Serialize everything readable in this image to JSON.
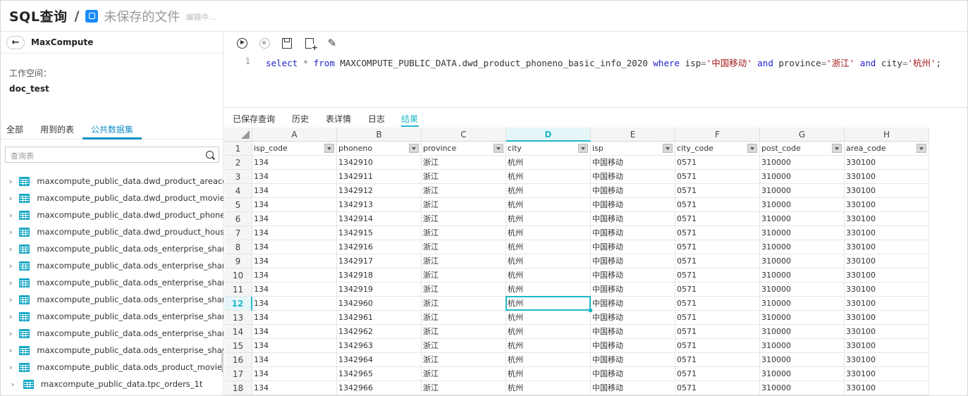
{
  "header": {
    "title": "SQL查询",
    "separator": "/",
    "file_name": "未保存的文件",
    "status": "编辑中..."
  },
  "left_panel": {
    "back_icon": "arrow-left-icon",
    "title": "MaxCompute",
    "workspace_label": "工作空间：",
    "workspace_value": "doc_test",
    "tabs": [
      "全部",
      "用到的表",
      "公共数据集"
    ],
    "active_tab": "公共数据集",
    "search_placeholder": "查询表",
    "tables": [
      "maxcompute_public_data.dwd_product_areacode",
      "maxcompute_public_data.dwd_product_movie_basic",
      "maxcompute_public_data.dwd_product_phoneno_basic",
      "maxcompute_public_data.dwd_prouduct_house",
      "maxcompute_public_data.ods_enterprise_share_basic",
      "maxcompute_public_data.ods_enterprise_share_quarter",
      "maxcompute_public_data.ods_enterprise_share_trade",
      "maxcompute_public_data.ods_enterprise_share_cashflow",
      "maxcompute_public_data.ods_enterprise_share_income",
      "maxcompute_public_data.ods_enterprise_share_profit",
      "maxcompute_public_data.ods_enterprise_share_holder",
      "maxcompute_public_data.ods_product_movie_box",
      "maxcompute_public_data.tpc_orders_1t"
    ]
  },
  "toolbar": {
    "icons": [
      "run-icon",
      "stop-icon",
      "save-icon",
      "save-as-icon",
      "format-icon"
    ]
  },
  "editor": {
    "line_number": "1",
    "tokens": [
      {
        "t": "select",
        "c": "kw"
      },
      {
        "t": " ",
        "c": "id"
      },
      {
        "t": "*",
        "c": "op"
      },
      {
        "t": " ",
        "c": "id"
      },
      {
        "t": "from",
        "c": "kw"
      },
      {
        "t": " MAXCOMPUTE_PUBLIC_DATA.dwd_product_phoneno_basic_info_2020 ",
        "c": "id"
      },
      {
        "t": "where",
        "c": "kw"
      },
      {
        "t": " isp",
        "c": "id"
      },
      {
        "t": "=",
        "c": "op"
      },
      {
        "t": "'中国移动'",
        "c": "str"
      },
      {
        "t": " ",
        "c": "id"
      },
      {
        "t": "and",
        "c": "kw"
      },
      {
        "t": " province",
        "c": "id"
      },
      {
        "t": "=",
        "c": "op"
      },
      {
        "t": "'浙江'",
        "c": "str"
      },
      {
        "t": " ",
        "c": "id"
      },
      {
        "t": "and",
        "c": "kw"
      },
      {
        "t": " city",
        "c": "id"
      },
      {
        "t": "=",
        "c": "op"
      },
      {
        "t": "'杭州'",
        "c": "str"
      },
      {
        "t": ";",
        "c": "id"
      }
    ]
  },
  "result_tabs": {
    "items": [
      "已保存查询",
      "历史",
      "表详情",
      "日志",
      "结果"
    ],
    "active": "结果"
  },
  "grid": {
    "columns": [
      "A",
      "B",
      "C",
      "D",
      "E",
      "F",
      "G",
      "H"
    ],
    "selected_column": "D",
    "selected_row": "12",
    "header_row": [
      "isp_code",
      "phoneno",
      "province",
      "city",
      "isp",
      "city_code",
      "post_code",
      "area_code"
    ],
    "rows": [
      [
        "134",
        "1342910",
        "浙江",
        "杭州",
        "中国移动",
        "0571",
        "310000",
        "330100"
      ],
      [
        "134",
        "1342911",
        "浙江",
        "杭州",
        "中国移动",
        "0571",
        "310000",
        "330100"
      ],
      [
        "134",
        "1342912",
        "浙江",
        "杭州",
        "中国移动",
        "0571",
        "310000",
        "330100"
      ],
      [
        "134",
        "1342913",
        "浙江",
        "杭州",
        "中国移动",
        "0571",
        "310000",
        "330100"
      ],
      [
        "134",
        "1342914",
        "浙江",
        "杭州",
        "中国移动",
        "0571",
        "310000",
        "330100"
      ],
      [
        "134",
        "1342915",
        "浙江",
        "杭州",
        "中国移动",
        "0571",
        "310000",
        "330100"
      ],
      [
        "134",
        "1342916",
        "浙江",
        "杭州",
        "中国移动",
        "0571",
        "310000",
        "330100"
      ],
      [
        "134",
        "1342917",
        "浙江",
        "杭州",
        "中国移动",
        "0571",
        "310000",
        "330100"
      ],
      [
        "134",
        "1342918",
        "浙江",
        "杭州",
        "中国移动",
        "0571",
        "310000",
        "330100"
      ],
      [
        "134",
        "1342919",
        "浙江",
        "杭州",
        "中国移动",
        "0571",
        "310000",
        "330100"
      ],
      [
        "134",
        "1342960",
        "浙江",
        "杭州",
        "中国移动",
        "0571",
        "310000",
        "330100"
      ],
      [
        "134",
        "1342961",
        "浙江",
        "杭州",
        "中国移动",
        "0571",
        "310000",
        "330100"
      ],
      [
        "134",
        "1342962",
        "浙江",
        "杭州",
        "中国移动",
        "0571",
        "310000",
        "330100"
      ],
      [
        "134",
        "1342963",
        "浙江",
        "杭州",
        "中国移动",
        "0571",
        "310000",
        "330100"
      ],
      [
        "134",
        "1342964",
        "浙江",
        "杭州",
        "中国移动",
        "0571",
        "310000",
        "330100"
      ],
      [
        "134",
        "1342965",
        "浙江",
        "杭州",
        "中国移动",
        "0571",
        "310000",
        "330100"
      ],
      [
        "134",
        "1342966",
        "浙江",
        "杭州",
        "中国移动",
        "0571",
        "310000",
        "330100"
      ]
    ]
  },
  "colors": {
    "accent": "#1fb8c9",
    "tab_active": "#1890c8",
    "table_icon": "#15a7c5",
    "keyword": "#2222cc",
    "string": "#a31515"
  }
}
